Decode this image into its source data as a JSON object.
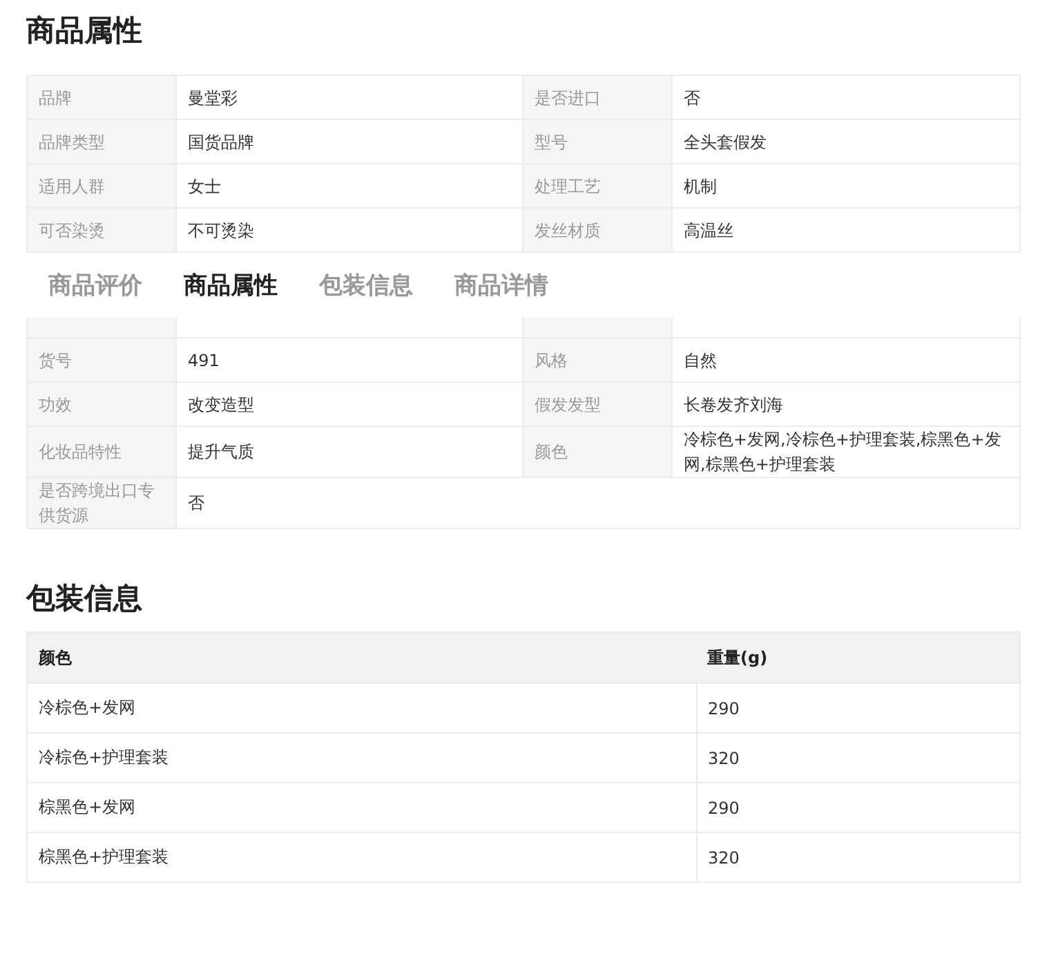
{
  "attributes": {
    "title": "商品属性",
    "rows_top": [
      {
        "cells": [
          {
            "label": "品牌",
            "value": "曼堂彩"
          },
          {
            "label": "是否进口",
            "value": "否"
          }
        ]
      },
      {
        "cells": [
          {
            "label": "品牌类型",
            "value": "国货品牌"
          },
          {
            "label": "型号",
            "value": "全头套假发"
          }
        ]
      },
      {
        "cells": [
          {
            "label": "适用人群",
            "value": "女士"
          },
          {
            "label": "处理工艺",
            "value": "机制"
          }
        ]
      },
      {
        "cells": [
          {
            "label": "可否染烫",
            "value": "不可烫染"
          },
          {
            "label": "发丝材质",
            "value": "高温丝"
          }
        ]
      }
    ],
    "rows_bottom": [
      {
        "cells": [
          {
            "label": "货号",
            "value": "491"
          },
          {
            "label": "风格",
            "value": "自然"
          }
        ]
      },
      {
        "cells": [
          {
            "label": "功效",
            "value": "改变造型"
          },
          {
            "label": "假发发型",
            "value": "长卷发齐刘海"
          }
        ]
      },
      {
        "cells": [
          {
            "label": "化妆品特性",
            "value": "提升气质"
          },
          {
            "label": "颜色",
            "value": "冷棕色+发网,冷棕色+护理套装,棕黑色+发网,棕黑色+护理套装"
          }
        ]
      },
      {
        "cells": [
          {
            "label": "是否跨境出口专供货源",
            "value": "否"
          }
        ]
      }
    ]
  },
  "tabs": [
    {
      "label": "商品评价",
      "selected": false
    },
    {
      "label": "商品属性",
      "selected": true
    },
    {
      "label": "包装信息",
      "selected": false
    },
    {
      "label": "商品详情",
      "selected": false
    }
  ],
  "packaging": {
    "title": "包装信息",
    "columns": [
      "颜色",
      "重量(g)"
    ],
    "rows": [
      [
        "冷棕色+发网",
        "290"
      ],
      [
        "冷棕色+护理套装",
        "320"
      ],
      [
        "棕黑色+发网",
        "290"
      ],
      [
        "棕黑色+护理套装",
        "320"
      ]
    ]
  }
}
